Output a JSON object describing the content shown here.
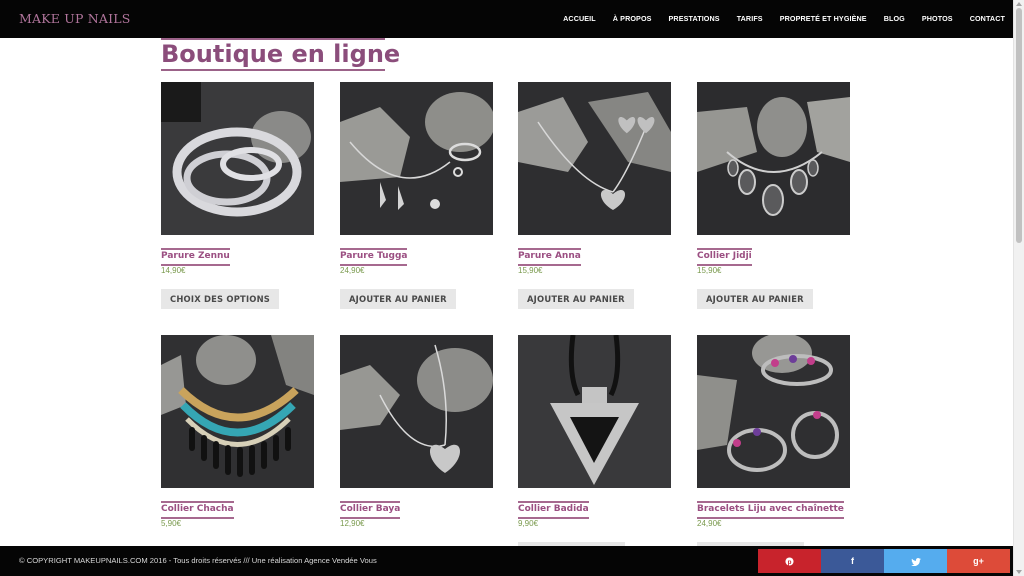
{
  "header": {
    "brand": "MAKE UP NAILS",
    "nav": [
      "ACCUEIL",
      "À PROPOS",
      "PRESTATIONS",
      "TARIFS",
      "PROPRETÉ ET HYGIÈNE",
      "BLOG",
      "PHOTOS",
      "CONTACT"
    ]
  },
  "page": {
    "title": "Boutique en ligne"
  },
  "products": [
    {
      "name": "Parure Zennu",
      "price": "14,90€",
      "button": "CHOIX DES OPTIONS"
    },
    {
      "name": "Parure Tugga",
      "price": "24,90€",
      "button": "AJOUTER AU PANIER"
    },
    {
      "name": "Parure Anna",
      "price": "15,90€",
      "button": "AJOUTER AU PANIER"
    },
    {
      "name": "Collier Jidji",
      "price": "15,90€",
      "button": "AJOUTER AU PANIER"
    },
    {
      "name": "Collier Chacha",
      "price": "5,90€"
    },
    {
      "name": "Collier Baya",
      "price": "12,90€"
    },
    {
      "name": "Collier Badida",
      "price": "9,90€"
    },
    {
      "name": "Bracelets Liju avec chaînette",
      "price": "24,90€"
    }
  ],
  "footer": {
    "copyright": "© COPYRIGHT MAKEUPNAILS.COM 2016 - Tous droits réservés /// Une réalisation Agence Vendée Vous",
    "social": [
      {
        "icon": "pinterest-icon",
        "glyph": "℗",
        "color": "#c8232c"
      },
      {
        "icon": "facebook-icon",
        "glyph": "f",
        "color": "#3b5998"
      },
      {
        "icon": "twitter-icon",
        "glyph": "🐦",
        "color": "#55acee"
      },
      {
        "icon": "google-plus-icon",
        "glyph": "g+",
        "color": "#dd4b39"
      }
    ]
  },
  "colors": {
    "accent": "#9b4f82",
    "price": "#7a9a4e",
    "header_bg": "#050505"
  }
}
